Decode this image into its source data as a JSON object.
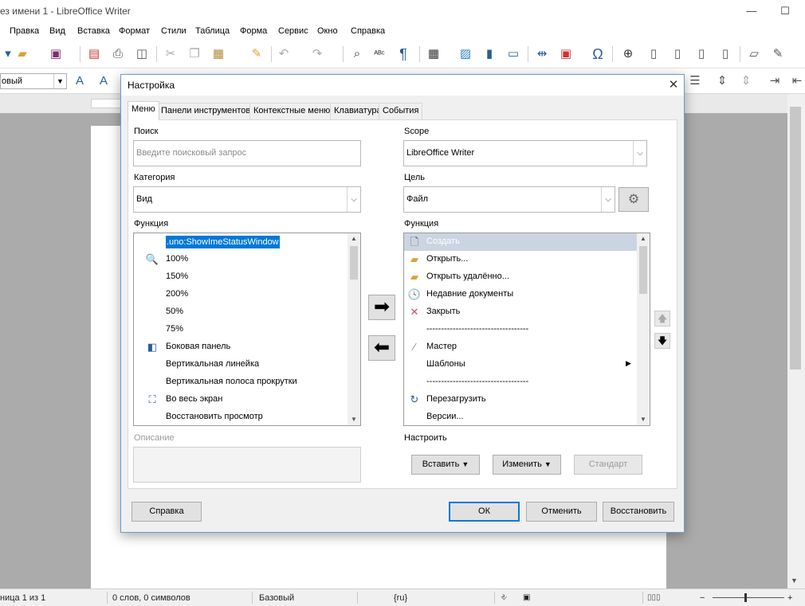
{
  "window": {
    "title": "ез имени 1 - LibreOffice Writer",
    "min_icon": "minimize-icon",
    "max_icon": "maximize-icon"
  },
  "menubar": [
    "Правка",
    "Вид",
    "Вставка",
    "Формат",
    "Стили",
    "Таблица",
    "Форма",
    "Сервис",
    "Окно",
    "Справка"
  ],
  "toolbar2": {
    "style_value": "овый"
  },
  "statusbar": {
    "page": "ница 1 из 1",
    "words": "0 слов, 0 символов",
    "style": "Базовый",
    "lang": "{ru}"
  },
  "dialog": {
    "title": "Настройка",
    "tabs": [
      "Меню",
      "Панели инструментов",
      "Контекстные меню",
      "Клавиатура",
      "События"
    ],
    "active_tab": "Меню",
    "left": {
      "search_label": "Поиск",
      "search_placeholder": "Введите поисковый запрос",
      "category_label": "Категория",
      "category_value": "Вид",
      "function_label": "Функция",
      "functions": [
        {
          "label": ".uno:ShowImeStatusWindow",
          "icon": "",
          "selected": true
        },
        {
          "label": "100%",
          "icon": "zoom-100-icon"
        },
        {
          "label": "150%",
          "icon": ""
        },
        {
          "label": "200%",
          "icon": ""
        },
        {
          "label": "50%",
          "icon": ""
        },
        {
          "label": "75%",
          "icon": ""
        },
        {
          "label": "Боковая панель",
          "icon": "sidebar-icon"
        },
        {
          "label": "Вертикальная линейка",
          "icon": ""
        },
        {
          "label": "Вертикальная полоса прокрутки",
          "icon": ""
        },
        {
          "label": "Во весь экран",
          "icon": "fullscreen-icon"
        },
        {
          "label": "Восстановить просмотр",
          "icon": ""
        }
      ],
      "description_label": "Описание"
    },
    "right": {
      "scope_label": "Scope",
      "scope_value": "LibreOffice Writer",
      "target_label": "Цель",
      "target_value": "Файл",
      "function_label": "Функция",
      "entries": [
        {
          "label": "Создать",
          "icon": "new-document-icon",
          "selected": true
        },
        {
          "label": "Открыть...",
          "icon": "folder-icon"
        },
        {
          "label": "Открыть удалённо...",
          "icon": "folder-icon"
        },
        {
          "label": "Недавние документы",
          "icon": "clock-icon"
        },
        {
          "label": "Закрыть",
          "icon": "close-x-icon"
        },
        {
          "label": "-----------------------------------",
          "icon": ""
        },
        {
          "label": "Мастер",
          "icon": "wand-icon"
        },
        {
          "label": "Шаблоны",
          "icon": "",
          "submenu": true
        },
        {
          "label": "-----------------------------------",
          "icon": ""
        },
        {
          "label": "Перезагрузить",
          "icon": "reload-icon"
        },
        {
          "label": "Версии...",
          "icon": ""
        }
      ],
      "customize_label": "Настроить",
      "insert_label": "Вставить",
      "modify_label": "Изменить",
      "default_label": "Стандарт"
    },
    "buttons": {
      "help": "Справка",
      "ok": "ОК",
      "cancel": "Отменить",
      "restore": "Восстановить"
    }
  }
}
